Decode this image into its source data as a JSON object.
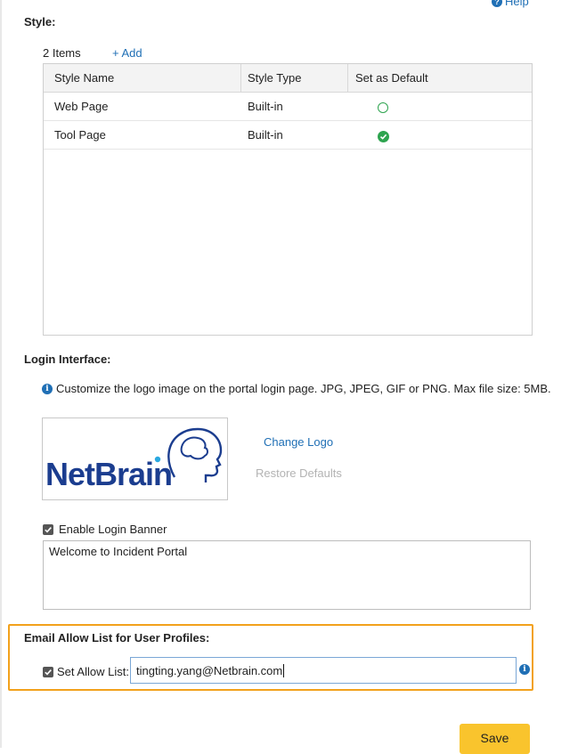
{
  "help": {
    "label": "Help"
  },
  "style": {
    "title": "Style:",
    "items_count": "2 Items",
    "add_label": "+ Add",
    "columns": [
      "Style Name",
      "Style Type",
      "Set as Default"
    ],
    "rows": [
      {
        "name": "Web Page",
        "type": "Built-in",
        "is_default": false
      },
      {
        "name": "Tool Page",
        "type": "Built-in",
        "is_default": true
      }
    ]
  },
  "login": {
    "title": "Login Interface:",
    "info_text": "Customize the logo image on the portal login page. JPG, JPEG, GIF or PNG. Max file size: 5MB.",
    "logo_text": "NetBrain",
    "change_logo": "Change Logo",
    "restore_defaults": "Restore Defaults",
    "enable_banner_label": "Enable Login Banner",
    "enable_banner_checked": true,
    "banner_text": "Welcome to Incident Portal"
  },
  "email": {
    "title": "Email Allow List for User Profiles:",
    "set_allow_label": "Set Allow List:",
    "set_allow_checked": true,
    "allow_value": "tingting.yang@Netbrain.com"
  },
  "save_label": "Save",
  "colors": {
    "accent": "#1f6fb5",
    "highlight_border": "#f2a11c",
    "save_button": "#f9c42d",
    "default_green": "#2ea44f",
    "logo_blue": "#1b3d8f"
  }
}
